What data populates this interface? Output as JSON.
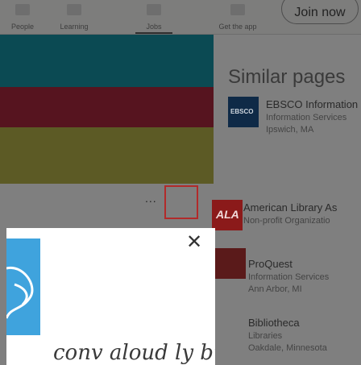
{
  "nav": {
    "items": [
      {
        "label": "People",
        "icon": "people-icon"
      },
      {
        "label": "Learning",
        "icon": "learning-icon"
      },
      {
        "label": "Jobs",
        "icon": "jobs-icon"
      },
      {
        "label": "Get the app",
        "icon": "app-icon"
      }
    ],
    "join_label": "Join now"
  },
  "similar": {
    "title": "Similar pages",
    "companies": [
      {
        "name": "EBSCO Information",
        "lines": [
          "Information Services",
          "Ipswich, MA"
        ],
        "logo_text": "EBSCO",
        "logo_color": "#0f2a47"
      },
      {
        "name": "American Library As",
        "lines": [
          "Non-profit Organizatio"
        ],
        "logo_text": "ALA",
        "logo_color": "#8b1a1a"
      },
      {
        "name": "ProQuest",
        "lines": [
          "Information Services",
          "Ann Arbor, MI"
        ],
        "logo_text": "",
        "logo_color": "#5a1a1a"
      },
      {
        "name": "Bibliotheca",
        "lines": [
          "Libraries",
          "Oakdale, Minnesota"
        ],
        "logo_text": "",
        "logo_color": "#7f7f7f"
      }
    ]
  },
  "promo": {
    "dots": "...",
    "colors": {
      "teal": "#0b4a53",
      "crimson": "#56141f",
      "olive": "#5c5a25"
    }
  },
  "panel": {
    "close_icon": "close-icon",
    "cursive_text": "conv aloud ly bury"
  }
}
